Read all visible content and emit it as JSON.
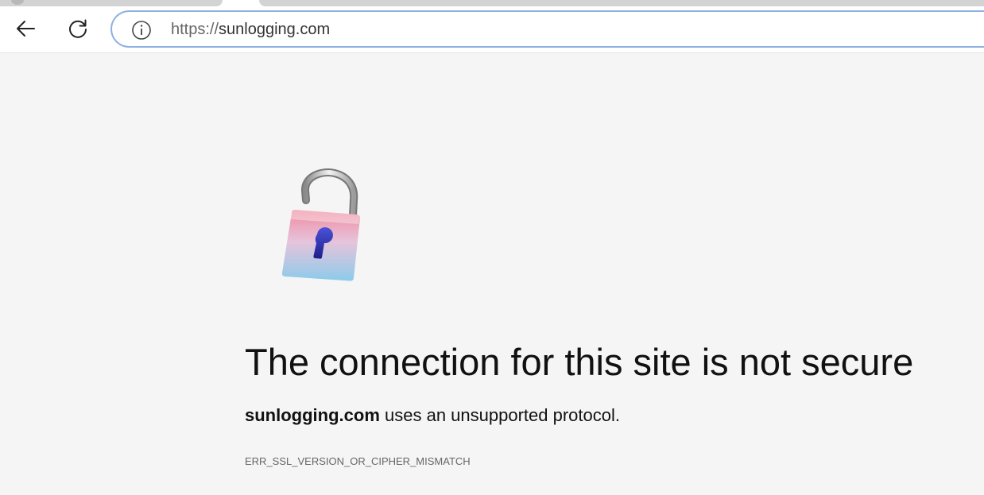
{
  "browser": {
    "address_bar": {
      "scheme": "https://",
      "host": "sunlogging.com"
    },
    "icons": {
      "back": "back-arrow-icon",
      "reload": "reload-icon",
      "site_info": "info-icon"
    }
  },
  "error_page": {
    "icon": "unlocked-padlock-icon",
    "headline": "The connection for this site is not secure",
    "description_domain": "sunlogging.com",
    "description_rest": " uses an unsupported protocol.",
    "error_code": "ERR_SSL_VERSION_OR_CIPHER_MISMATCH"
  },
  "colors": {
    "page_background": "#f5f5f5",
    "address_bar_border": "#8fb1e2",
    "lock_top": "#f08a9e",
    "lock_bottom": "#8ccbea",
    "keyhole": "#2a2fa8"
  }
}
